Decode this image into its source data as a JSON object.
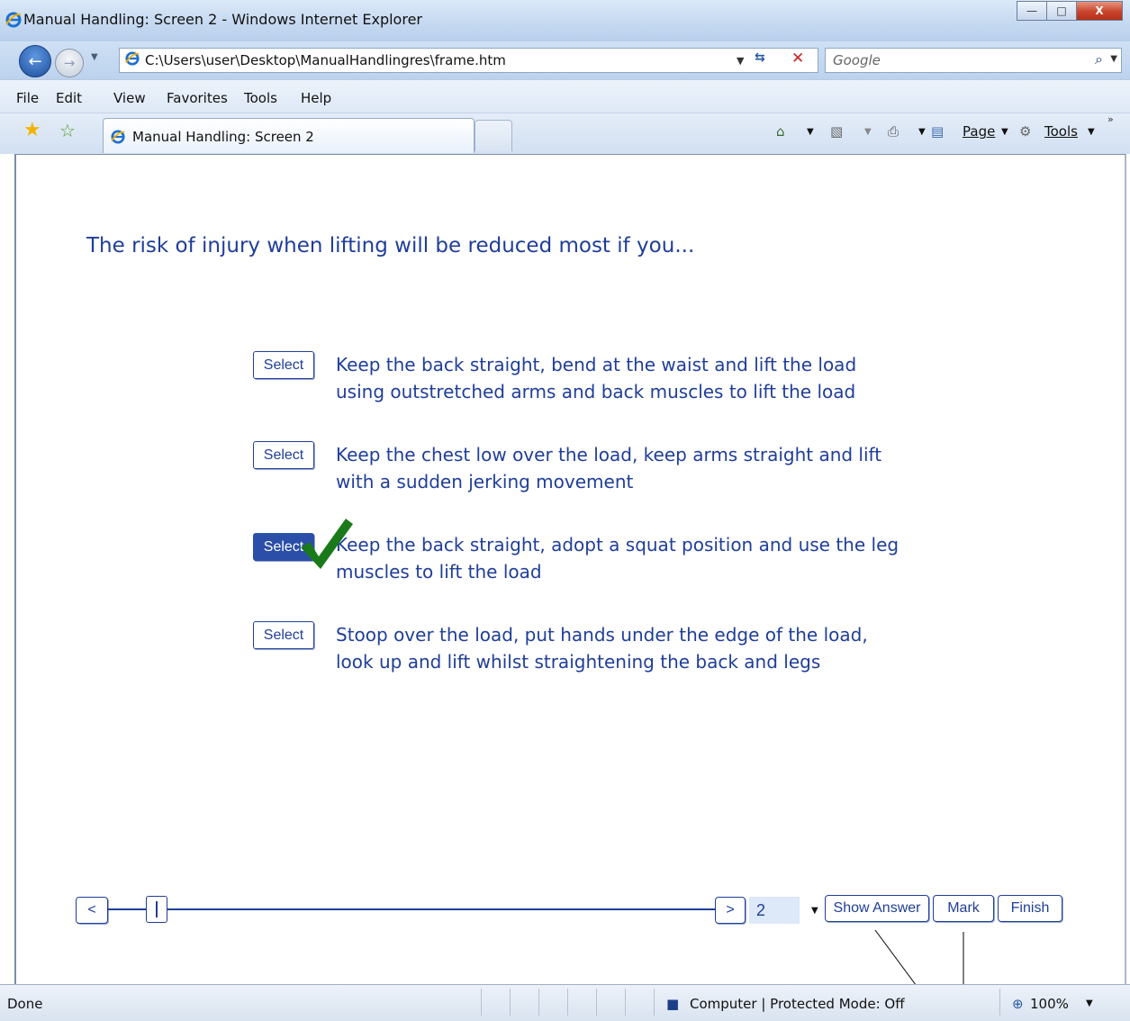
{
  "window": {
    "title": "Manual Handling: Screen 2 - Windows Internet Explorer",
    "minimize_glyph": "—",
    "maximize_glyph": "□",
    "close_glyph": "X"
  },
  "address_bar": {
    "url": "C:\\Users\\user\\Desktop\\ManualHandlingres\\frame.htm",
    "search_placeholder": "Google"
  },
  "menu": {
    "items": [
      "File",
      "Edit",
      "View",
      "Favorites",
      "Tools",
      "Help"
    ]
  },
  "tabs": {
    "active_title": "Manual Handling: Screen 2"
  },
  "command_bar": {
    "page_label": "Page",
    "tools_label": "Tools"
  },
  "quiz": {
    "question": "The risk of injury when lifting will be reduced most if you...",
    "select_label": "Select",
    "options": [
      {
        "line1": "Keep the back straight, bend at the waist and lift the load",
        "line2": "using outstretched arms and back muscles to lift the load",
        "selected": false
      },
      {
        "line1": "Keep the chest low over the load, keep arms straight and lift",
        "line2": "with a sudden jerking movement",
        "selected": false
      },
      {
        "line1": "Keep the back straight, adopt a squat position and use the leg",
        "line2": "muscles to lift the load",
        "selected": true
      },
      {
        "line1": "Stoop over the load, put hands under the edge of the load,",
        "line2": "look up and lift whilst straightening the back and legs",
        "selected": false
      }
    ],
    "correct_option_index": 2
  },
  "navigation": {
    "prev_label": "<",
    "next_label": ">",
    "page_number": "2",
    "show_answer_label": "Show Answer",
    "mark_label": "Mark",
    "finish_label": "Finish"
  },
  "status_bar": {
    "status_text": "Done",
    "zone_text": "Computer | Protected Mode: Off",
    "zoom": "100%"
  },
  "colors": {
    "accent": "#1f3e99",
    "selected_fill": "#2b4fa8",
    "check_green": "#1a7a1a"
  }
}
